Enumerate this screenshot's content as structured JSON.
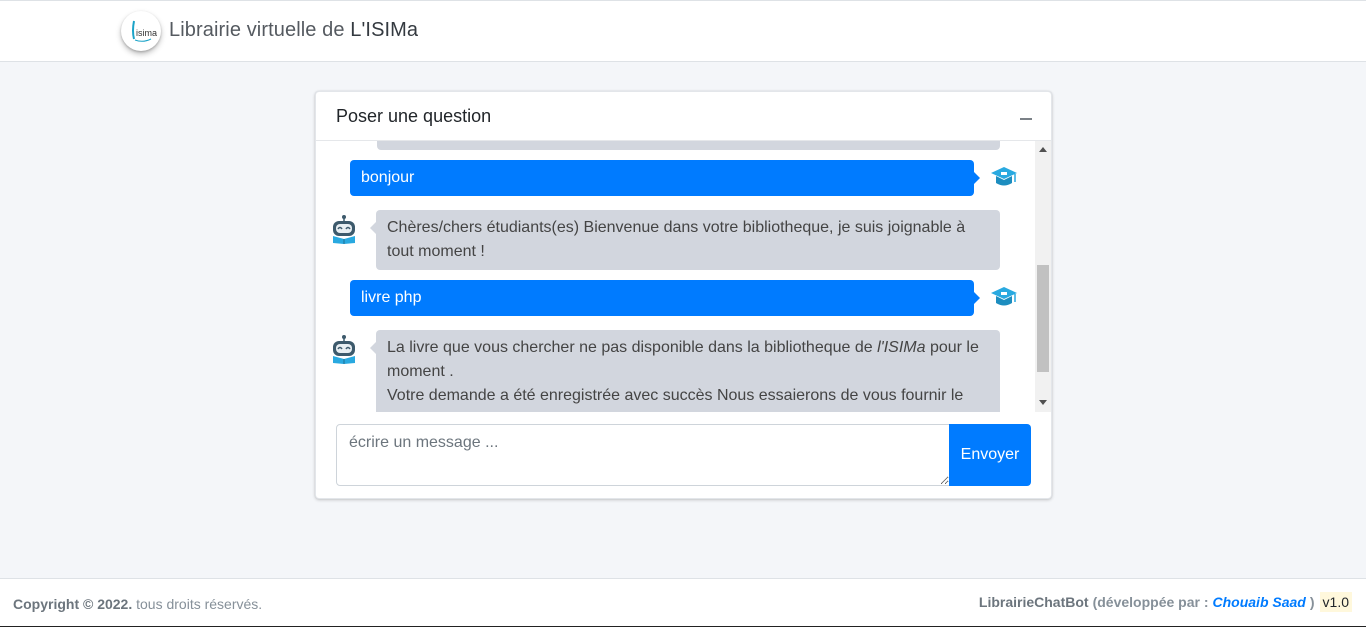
{
  "header": {
    "brand_prefix": "Librairie virtuelle de ",
    "brand_name": "L'ISIMa",
    "logo_text": "isima"
  },
  "chat": {
    "title": "Poser une question",
    "messages": [
      {
        "from": "user",
        "text": "bonjour"
      },
      {
        "from": "bot",
        "text": "Chères/chers étudiants(es) Bienvenue dans votre bibliotheque, je suis joignable à tout moment !"
      },
      {
        "from": "user",
        "text": "livre php"
      },
      {
        "from": "bot",
        "text_before": "La livre que vous chercher ne pas disponible dans la bibliotheque de ",
        "text_emph": "l'ISIMa",
        "text_after": " pour le moment .",
        "text_line2": "Votre demande a été enregistrée avec succès Nous essaierons de vous fournir le livre"
      }
    ],
    "input_placeholder": "écrire un message ...",
    "send_label": "Envoyer"
  },
  "footer": {
    "copyright": "Copyright © 2022.",
    "rights": " tous droits réservés.",
    "app_name": "LibrairieChatBot",
    "dev_label": "(développée par :",
    "author": "Chouaib Saad",
    "close": ")",
    "version": "v1.0"
  },
  "colors": {
    "primary": "#007bff",
    "bot_bubble": "#d2d6de",
    "background": "#f4f6f9",
    "user_icon": "#29a9e0"
  }
}
